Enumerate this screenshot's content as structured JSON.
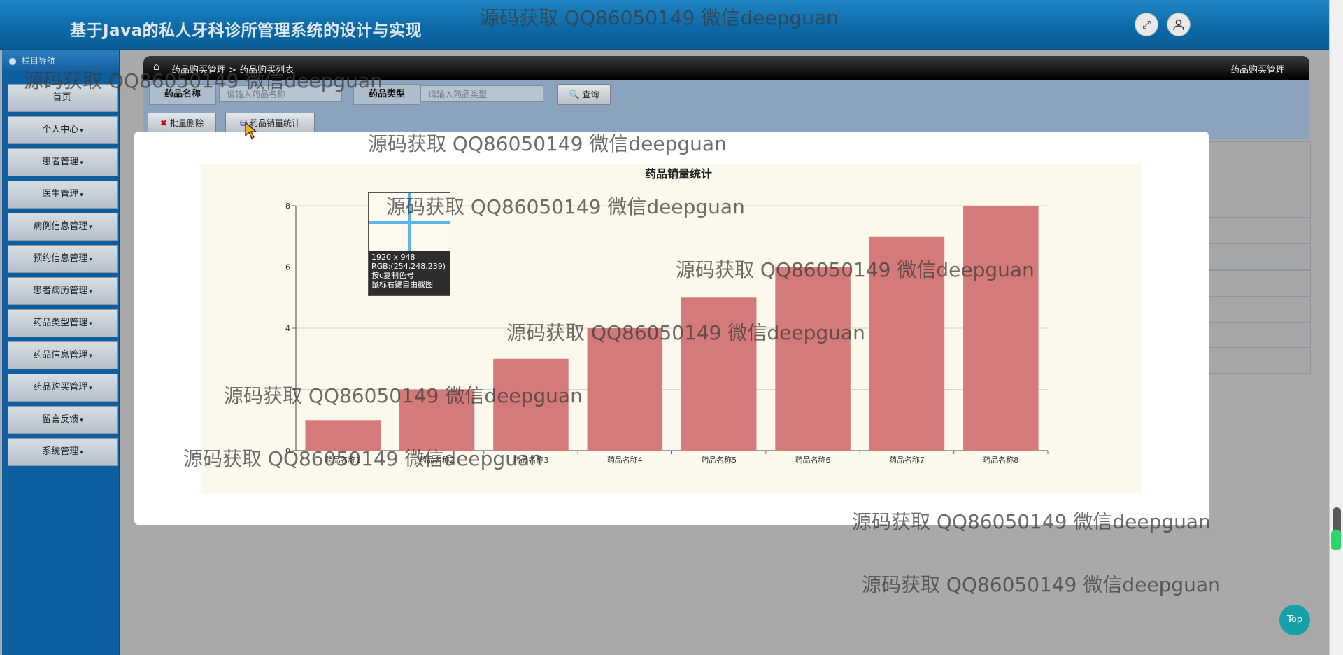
{
  "header": {
    "title": "基于Java的私人牙科诊所管理系统的设计与实现",
    "fullscreen_icon": "expand-icon",
    "user_icon": "user-icon"
  },
  "sidebar": {
    "heading": "栏目导航",
    "items": [
      {
        "label": "首页",
        "caret": ""
      },
      {
        "label": "个人中心",
        "caret": "▾"
      },
      {
        "label": "患者管理",
        "caret": "▾"
      },
      {
        "label": "医生管理",
        "caret": "▾"
      },
      {
        "label": "病例信息管理",
        "caret": "▾"
      },
      {
        "label": "预约信息管理",
        "caret": "▾"
      },
      {
        "label": "患者病历管理",
        "caret": "▾"
      },
      {
        "label": "药品类型管理",
        "caret": "▾"
      },
      {
        "label": "药品信息管理",
        "caret": "▾"
      },
      {
        "label": "药品购买管理",
        "caret": "▾"
      },
      {
        "label": "留言反馈",
        "caret": "▾"
      },
      {
        "label": "系统管理",
        "caret": "▾"
      }
    ]
  },
  "breadcrumb": {
    "path": "药品购买管理 > 药品购买列表",
    "right": "药品购买管理"
  },
  "search": {
    "name_label": "药品名称",
    "name_placeholder": "请输入药品名称",
    "type_label": "药品类型",
    "type_placeholder": "请输入药品类型",
    "query_button": "查询"
  },
  "toolbar": {
    "batch_delete": "批量删除",
    "stats_button": "药品销量统计"
  },
  "chart_data": {
    "type": "bar",
    "title": "药品销量统计",
    "categories": [
      "药品名称1",
      "药品名称2",
      "药品名称3",
      "药品名称4",
      "药品名称5",
      "药品名称6",
      "药品名称7",
      "药品名称8"
    ],
    "values": [
      1,
      2,
      3,
      4,
      5,
      6,
      7,
      8
    ],
    "ylim": [
      0,
      8
    ],
    "yticks": [
      0,
      2,
      4,
      6,
      8
    ],
    "ytick_labels": [
      "0",
      "",
      "4",
      "6",
      "8"
    ],
    "bar_color": "#d57a7a",
    "background": "#fbf8ec",
    "grid": true
  },
  "color_picker": {
    "size": "1920 x 948",
    "rgb": "RGB:(254,248,239)",
    "hint1": "按c复制色号",
    "hint2": "鼠标右键自由截图"
  },
  "watermark": "源码获取 QQ86050149 微信deepguan",
  "top_button": "Top"
}
